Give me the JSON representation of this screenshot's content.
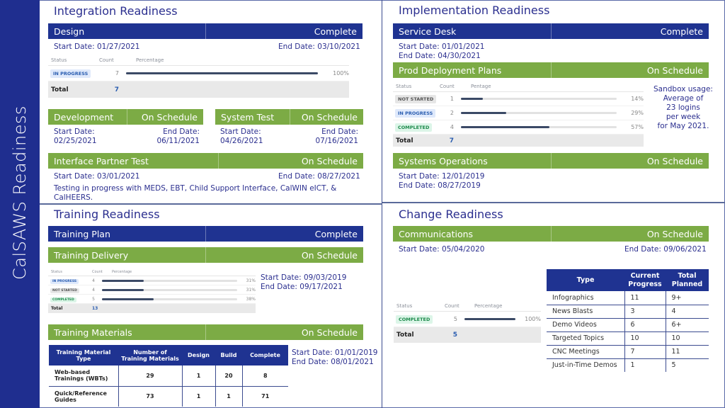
{
  "sidebar": {
    "title": "CalSAWS Readiness"
  },
  "integration": {
    "title": "Integration Readiness",
    "design": {
      "label": "Design",
      "status": "Complete",
      "start": "Start Date: 01/27/2021",
      "end": "End Date: 03/10/2021",
      "widget": {
        "headers": [
          "Status",
          "Count",
          "Percentage"
        ],
        "rows": [
          {
            "status": "IN PROGRESS",
            "kind": "inprog",
            "count": "7",
            "percent": 100,
            "percent_label": "100%"
          }
        ],
        "total_label": "Total",
        "total": "7"
      }
    },
    "development": {
      "label": "Development",
      "status": "On Schedule",
      "start_label": "Start Date:",
      "start": "02/25/2021",
      "end_label": "End Date:",
      "end": "06/11/2021"
    },
    "system_test": {
      "label": "System Test",
      "status": "On Schedule",
      "start_label": "Start Date:",
      "start": "04/26/2021",
      "end_label": "End Date:",
      "end": "07/16/2021"
    },
    "interface": {
      "label": "Interface Partner Test",
      "status": "On Schedule",
      "start": "Start Date: 03/01/2021",
      "end": "End Date: 08/27/2021",
      "note": "Testing in progress with MEDS, EBT, Child Support Interface, CalWIN eICT, &",
      "note2": "CalHEERS."
    }
  },
  "implementation": {
    "title": "Implementation Readiness",
    "service_desk": {
      "label": "Service Desk",
      "status": "Complete",
      "start": "Start Date: 01/01/2021",
      "end": "End Date: 04/30/2021"
    },
    "prod_deploy": {
      "label": "Prod Deployment Plans",
      "status": "On Schedule",
      "widget": {
        "headers": [
          "Status",
          "Count",
          "Pentage"
        ],
        "rows": [
          {
            "status": "NOT STARTED",
            "kind": "notstart",
            "count": "1",
            "percent": 14,
            "percent_label": "14%"
          },
          {
            "status": "IN PROGRESS",
            "kind": "inprog",
            "count": "2",
            "percent": 29,
            "percent_label": "29%"
          },
          {
            "status": "COMPLETED",
            "kind": "done",
            "count": "4",
            "percent": 57,
            "percent_label": "57%"
          }
        ],
        "total_label": "Total",
        "total": "7"
      }
    },
    "sandbox": [
      "Sandbox usage:",
      "Average of",
      "23 logins",
      "per week",
      "for May 2021."
    ],
    "sys_ops": {
      "label": "Systems Operations",
      "status": "On Schedule",
      "start": "Start Date: 12/01/2019",
      "end": "End Date: 08/27/2019"
    }
  },
  "training": {
    "title": "Training Readiness",
    "plan": {
      "label": "Training Plan",
      "status": "Complete"
    },
    "delivery": {
      "label": "Training Delivery",
      "status": "On Schedule",
      "start": "Start Date: 09/03/2019",
      "end": "End Date: 09/17/2021",
      "widget": {
        "headers": [
          "Status",
          "Count",
          "Percentage"
        ],
        "rows": [
          {
            "status": "IN PROGRESS",
            "kind": "inprog",
            "count": "4",
            "percent": 31,
            "percent_label": "31%"
          },
          {
            "status": "NOT STARTED",
            "kind": "notstart",
            "count": "4",
            "percent": 31,
            "percent_label": "31%"
          },
          {
            "status": "COMPLETED",
            "kind": "done",
            "count": "5",
            "percent": 38,
            "percent_label": "38%"
          }
        ],
        "total_label": "Total",
        "total": "13"
      }
    },
    "materials": {
      "label": "Training Materials",
      "status": "On Schedule",
      "start": "Start Date: 01/01/2019",
      "end": "End Date: 08/01/2021",
      "table": {
        "headers": [
          "Training Material Type",
          "Number of Training Materials",
          "Design",
          "Build",
          "Complete"
        ],
        "rows": [
          [
            "Web-based Trainings (WBTs)",
            "29",
            "1",
            "20",
            "8"
          ],
          [
            "Quick/Reference Guides",
            "73",
            "1",
            "1",
            "71"
          ]
        ]
      }
    }
  },
  "change": {
    "title": "Change Readiness",
    "comms": {
      "label": "Communications",
      "status": "On Schedule",
      "start": "Start Date: 05/04/2020",
      "end": "End Date: 09/06/2021",
      "widget": {
        "headers": [
          "Status",
          "Count",
          "Percentage"
        ],
        "rows": [
          {
            "status": "COMPLETED",
            "kind": "done",
            "count": "5",
            "percent": 100,
            "percent_label": "100%"
          }
        ],
        "total_label": "Total",
        "total": "5"
      }
    },
    "table": {
      "headers": [
        "Type",
        "Current Progress",
        "Total Planned"
      ],
      "rows": [
        [
          "Infographics",
          "11",
          "9+"
        ],
        [
          "News Blasts",
          "3",
          "4"
        ],
        [
          "Demo Videos",
          "6",
          "6+"
        ],
        [
          "Targeted Topics",
          "10",
          "10"
        ],
        [
          "CNC Meetings",
          "7",
          "11"
        ],
        [
          "Just-in-Time Demos",
          "1",
          "5"
        ]
      ]
    }
  }
}
